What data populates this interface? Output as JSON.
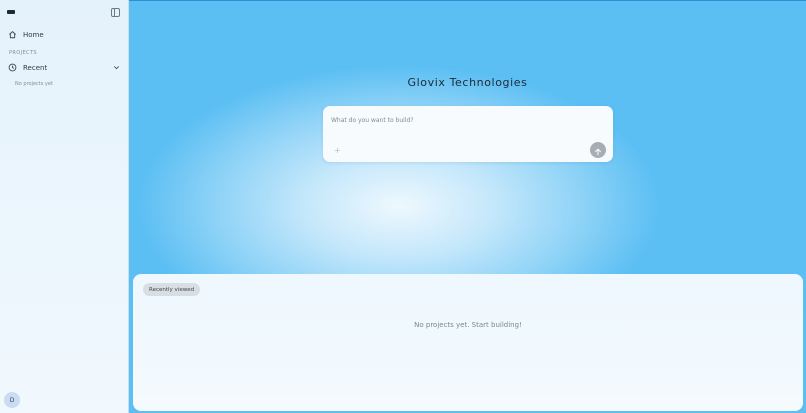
{
  "sidebar": {
    "nav_home_label": "Home",
    "section_label": "PROJECTS",
    "nav_recent_label": "Recent",
    "empty_note": "No projects yet",
    "avatar_initial": "D"
  },
  "main": {
    "title": "Glovix Technologies",
    "prompt": {
      "placeholder": "What do you want to build?",
      "value": "",
      "attach_glyph": "+"
    },
    "recent_chip_label": "Recently viewed",
    "recent_empty_text": "No projects yet. Start building!"
  },
  "icons": {
    "home": "home-icon",
    "clock": "clock-icon",
    "chevron": "chevron-down-icon",
    "sidebar_toggle": "sidebar-toggle-icon",
    "send": "arrow-up-icon"
  },
  "colors": {
    "accent_blue": "#5cbff3",
    "send_button": "#a7adb2",
    "chip": "#d9dee3"
  }
}
